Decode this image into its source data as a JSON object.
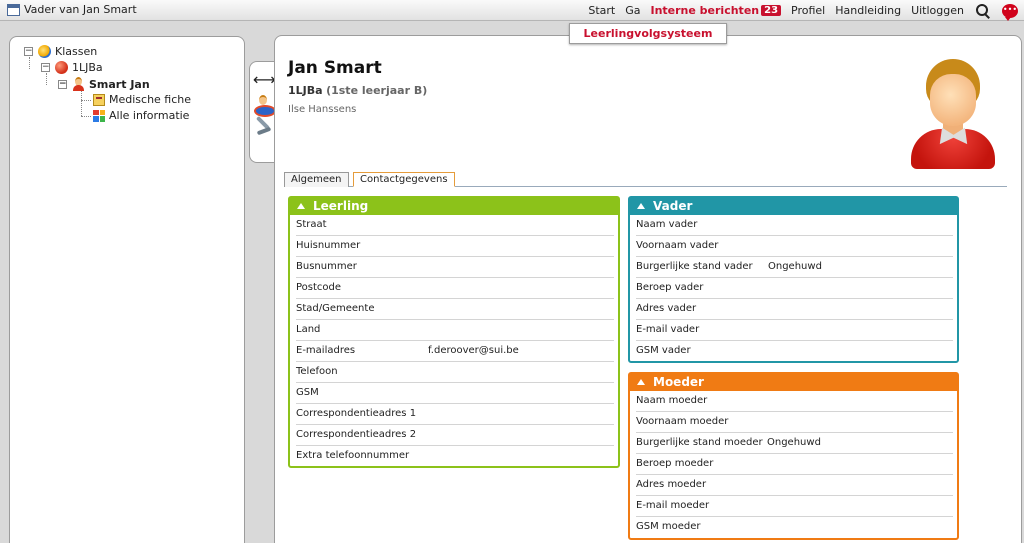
{
  "window": {
    "title": "Vader van Jan Smart"
  },
  "nav": {
    "start": "Start",
    "ga": "Ga",
    "messages": "Interne berichten",
    "messages_count": "23",
    "profile": "Profiel",
    "manual": "Handleiding",
    "logout": "Uitloggen"
  },
  "tree": {
    "root": "Klassen",
    "class": "1LJBa",
    "student": "Smart Jan",
    "children": [
      "Medische fiche",
      "Alle informatie"
    ]
  },
  "tools": {
    "resize": "⟷"
  },
  "system_tab": "Leerlingvolgsysteem",
  "student": {
    "name": "Jan Smart",
    "class_code": "1LJBa",
    "class_desc": "(1ste leerjaar B)",
    "teacher": "Ilse Hanssens"
  },
  "tabs": [
    "Algemeen",
    "Contactgegevens"
  ],
  "active_tab": "Contactgegevens",
  "sections": {
    "leerling": {
      "title": "Leerling",
      "color": "#8cc21a",
      "rows": [
        {
          "label": "Straat",
          "value": ""
        },
        {
          "label": "Huisnummer",
          "value": ""
        },
        {
          "label": "Busnummer",
          "value": ""
        },
        {
          "label": "Postcode",
          "value": ""
        },
        {
          "label": "Stad/Gemeente",
          "value": ""
        },
        {
          "label": "Land",
          "value": ""
        },
        {
          "label": "E-mailadres",
          "value": "f.deroover@sui.be"
        },
        {
          "label": "Telefoon",
          "value": ""
        },
        {
          "label": "GSM",
          "value": ""
        },
        {
          "label": "Correspondentieadres 1",
          "value": ""
        },
        {
          "label": "Correspondentieadres 2",
          "value": ""
        },
        {
          "label": "Extra telefoonnummer",
          "value": ""
        }
      ]
    },
    "vader": {
      "title": "Vader",
      "color": "#2196a6",
      "rows": [
        {
          "label": "Naam vader",
          "value": ""
        },
        {
          "label": "Voornaam vader",
          "value": ""
        },
        {
          "label": "Burgerlijke stand vader",
          "value": "Ongehuwd"
        },
        {
          "label": "Beroep vader",
          "value": ""
        },
        {
          "label": "Adres vader",
          "value": ""
        },
        {
          "label": "E-mail vader",
          "value": ""
        },
        {
          "label": "GSM vader",
          "value": ""
        }
      ]
    },
    "moeder": {
      "title": "Moeder",
      "color": "#f07b14",
      "rows": [
        {
          "label": "Naam moeder",
          "value": ""
        },
        {
          "label": "Voornaam moeder",
          "value": ""
        },
        {
          "label": "Burgerlijke stand moeder",
          "value": "Ongehuwd"
        },
        {
          "label": "Beroep moeder",
          "value": ""
        },
        {
          "label": "Adres moeder",
          "value": ""
        },
        {
          "label": "E-mail moeder",
          "value": ""
        },
        {
          "label": "GSM moeder",
          "value": ""
        }
      ]
    }
  },
  "icons": {
    "window": "window-icon",
    "search": "search-icon",
    "chat": "chat-bubble-icon",
    "globe": "globe-icon",
    "class": "class-ball-icon",
    "student": "person-icon",
    "medical": "medical-card-icon",
    "all_info": "grid-icon"
  }
}
